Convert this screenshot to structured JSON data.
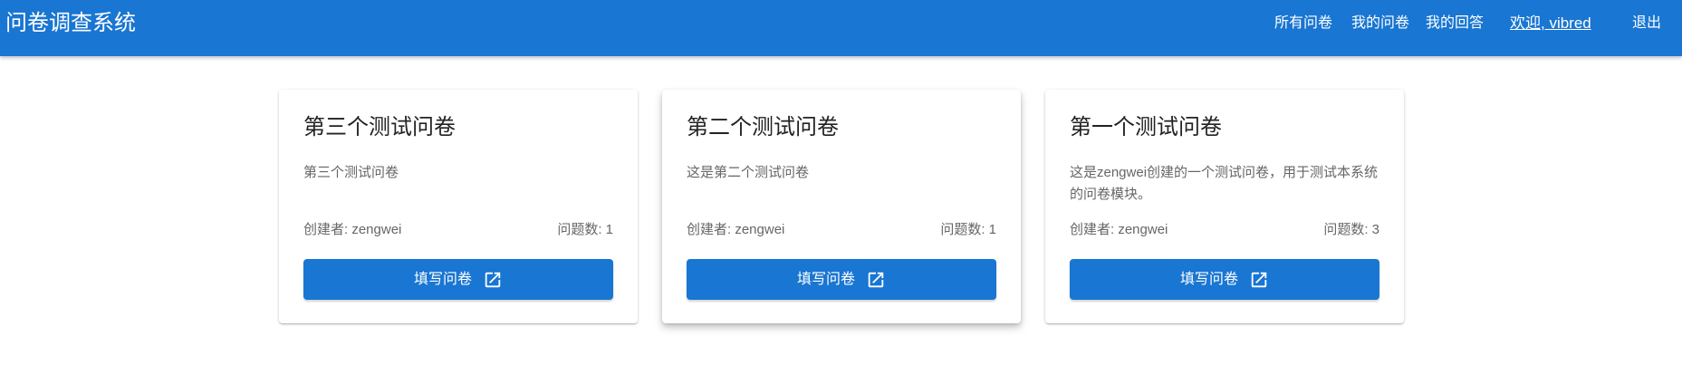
{
  "app": {
    "title": "问卷调查系统"
  },
  "nav": {
    "all_surveys": "所有问卷",
    "my_surveys": "我的问卷",
    "my_answers": "我的回答",
    "welcome": "欢迎, vibred",
    "logout": "退出"
  },
  "cards": [
    {
      "title": "第三个测试问卷",
      "description": "第三个测试问卷",
      "creator": "创建者: zengwei",
      "question_count": "问题数: 1",
      "button_label": "填写问卷",
      "button_icon": "open-in-new-icon"
    },
    {
      "title": "第二个测试问卷",
      "description": "这是第二个测试问卷",
      "creator": "创建者: zengwei",
      "question_count": "问题数: 1",
      "button_label": "填写问卷",
      "button_icon": "open-in-new-icon"
    },
    {
      "title": "第一个测试问卷",
      "description": "这是zengwei创建的一个测试问卷，用于测试本系统的问卷模块。",
      "creator": "创建者: zengwei",
      "question_count": "问题数: 3",
      "button_label": "填写问卷",
      "button_icon": "open-in-new-icon"
    }
  ],
  "colors": {
    "primary": "#1976d2",
    "text_primary": "#222222",
    "text_secondary": "#666666"
  }
}
